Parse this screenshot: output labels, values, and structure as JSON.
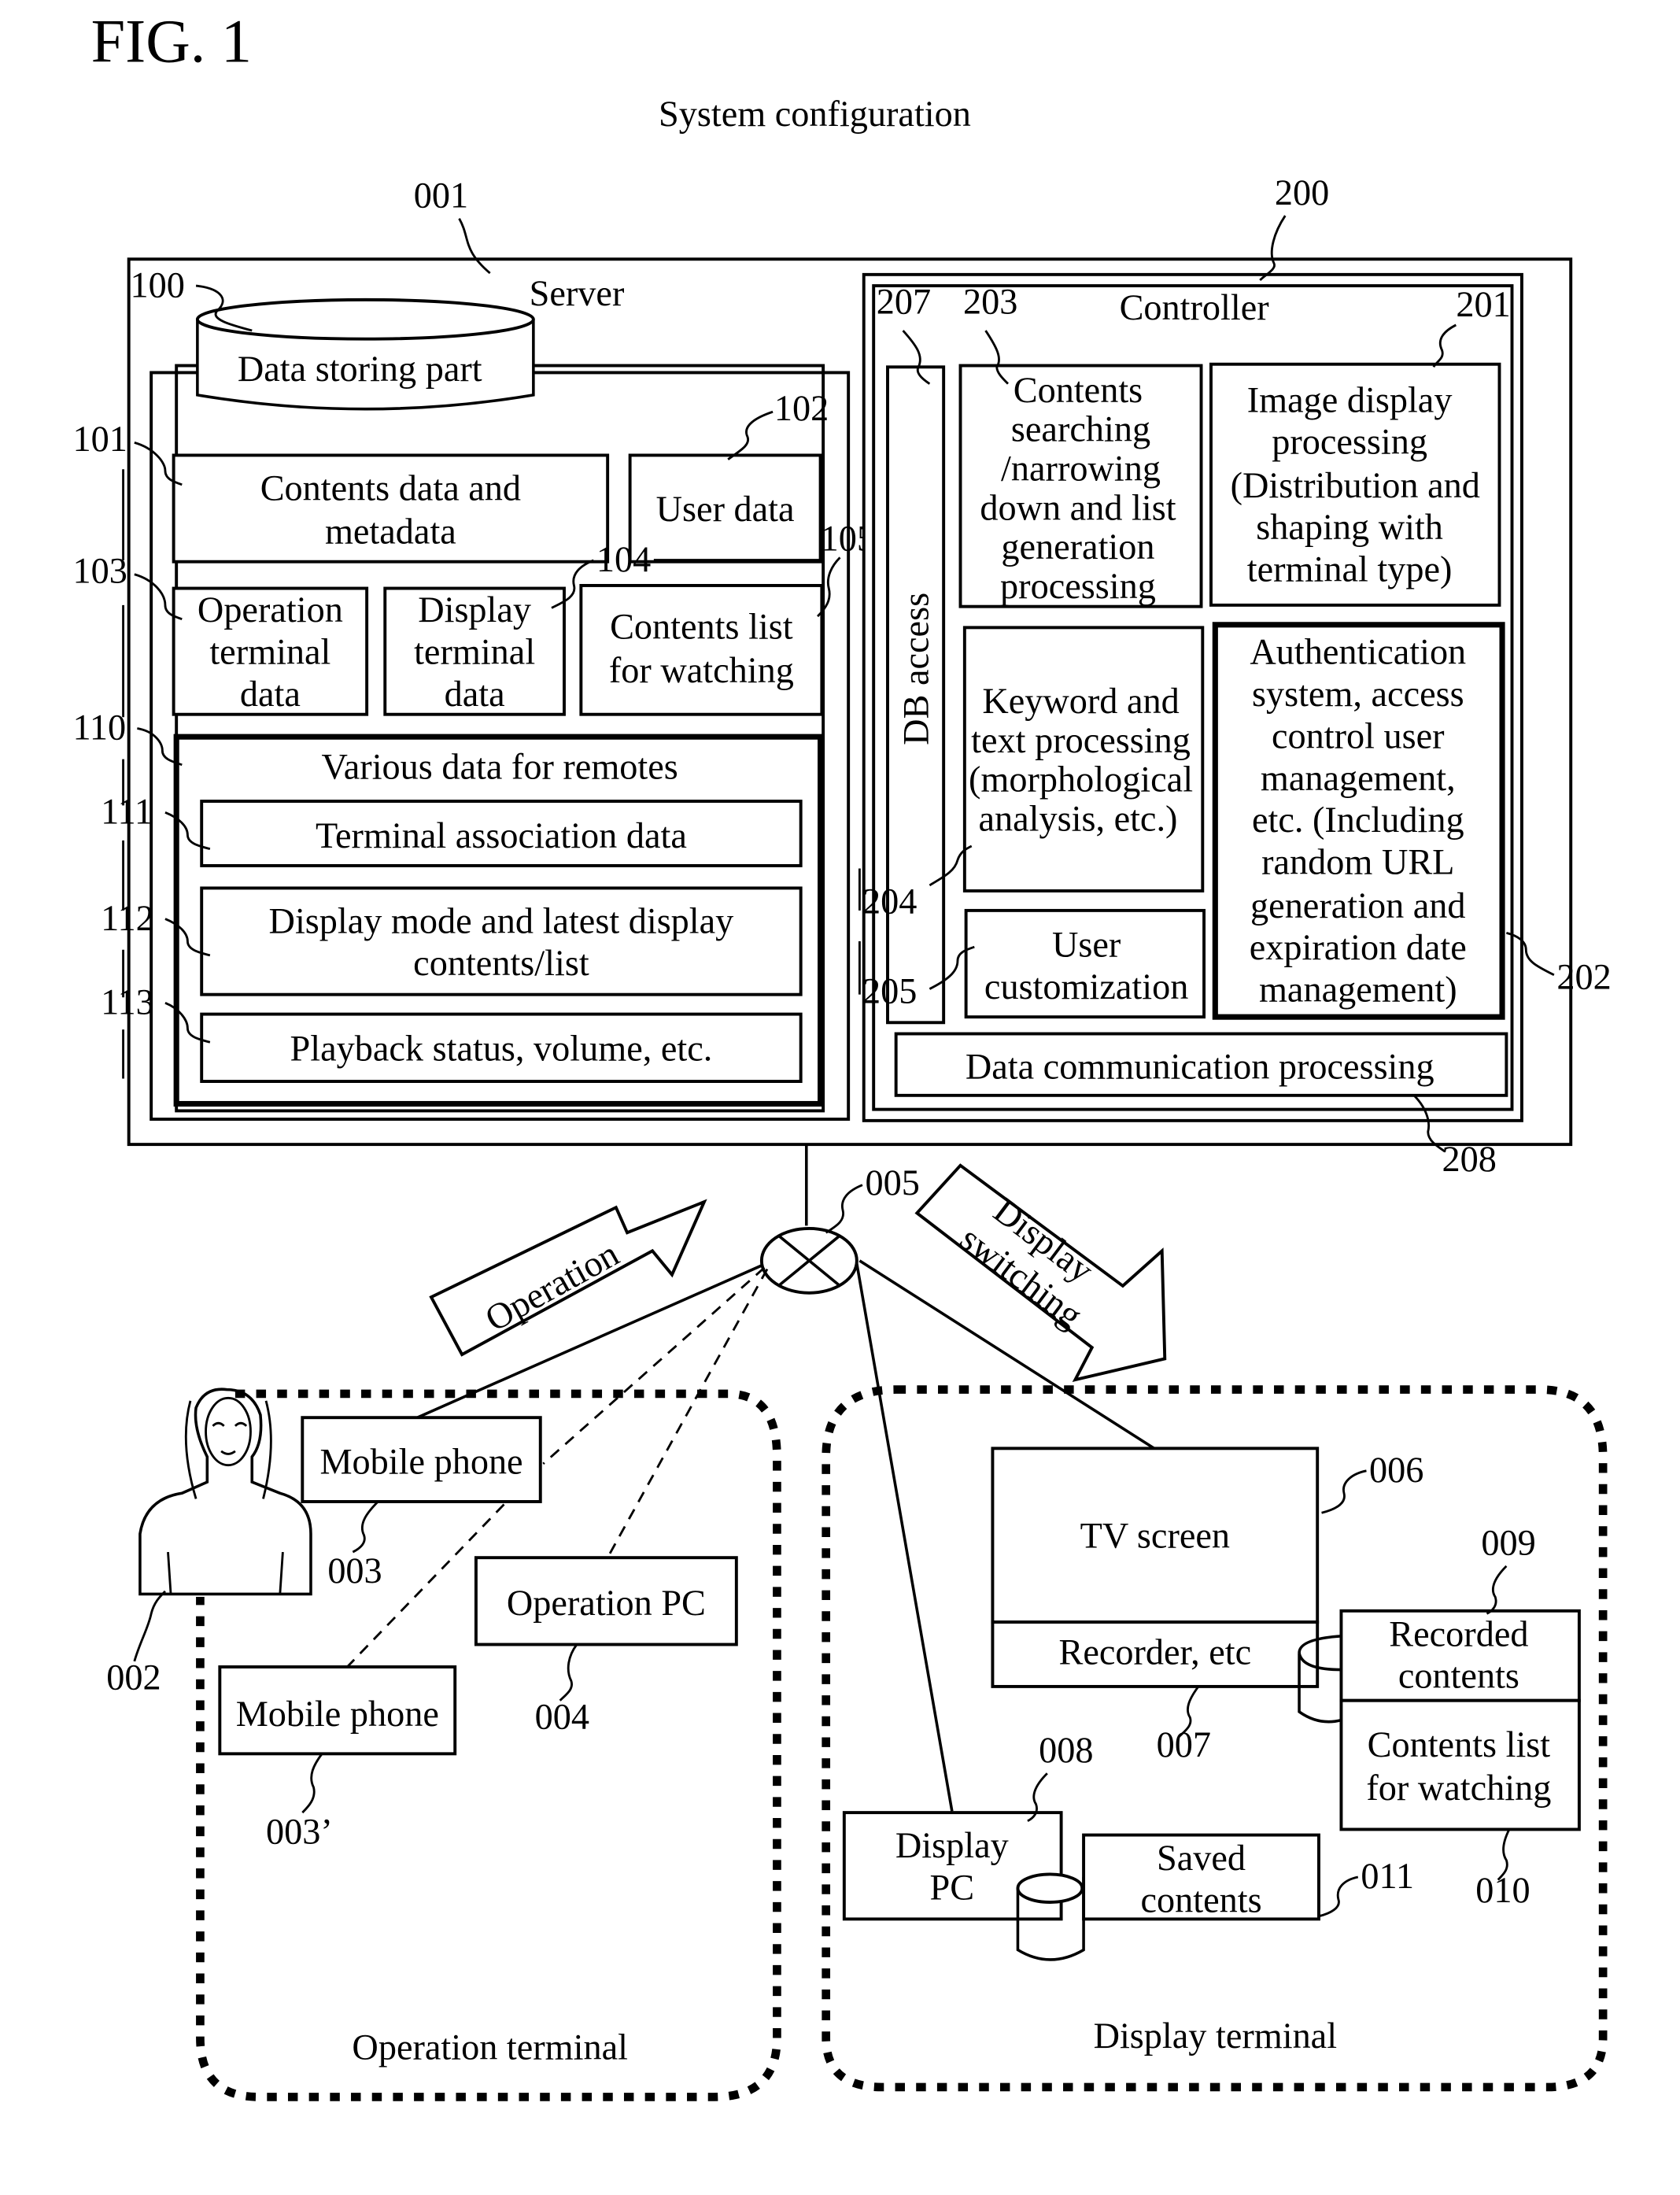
{
  "figure": {
    "label": "FIG. 1",
    "subtitle": "System configuration"
  },
  "server": {
    "ref": "001",
    "label": "Server",
    "data_storing_part": {
      "ref": "100",
      "label": "Data storing part",
      "items": {
        "contents_data": {
          "ref": "101",
          "lines": [
            "Contents data and",
            "metadata"
          ]
        },
        "user_data": {
          "ref": "102",
          "lines": [
            "User data"
          ]
        },
        "operation_terminal_data": {
          "ref": "103",
          "lines": [
            "Operation",
            "terminal",
            "data"
          ]
        },
        "display_terminal_data": {
          "ref": "104",
          "lines": [
            "Display",
            "terminal",
            "data"
          ]
        },
        "contents_list": {
          "ref": "105",
          "lines": [
            "Contents list",
            "for watching"
          ]
        }
      },
      "remotes": {
        "ref": "110",
        "label": "Various data for remotes",
        "terminal_association": {
          "ref": "111",
          "lines": [
            "Terminal association data"
          ]
        },
        "display_mode": {
          "ref": "112",
          "lines": [
            "Display mode and latest display",
            "contents/list"
          ]
        },
        "playback_status": {
          "ref": "113",
          "lines": [
            "Playback status, volume, etc."
          ]
        }
      }
    },
    "controller": {
      "ref": "200",
      "label": "Controller",
      "db_access": {
        "ref": "207",
        "label": "DB access"
      },
      "contents_searching": {
        "ref": "203",
        "lines": [
          "Contents",
          "searching",
          "/narrowing",
          "down and list",
          "generation",
          "processing"
        ]
      },
      "image_display": {
        "ref": "201",
        "lines": [
          "Image display",
          "processing",
          "(Distribution and",
          "shaping with",
          "terminal type)"
        ]
      },
      "keyword_processing": {
        "ref": "204",
        "lines": [
          "Keyword and",
          "text processing",
          "(morphological",
          "analysis, etc.)"
        ]
      },
      "authentication": {
        "ref": "202",
        "lines": [
          "Authentication",
          "system, access",
          "control user",
          "management,",
          "etc. (Including",
          "random URL",
          "generation and",
          "expiration date",
          "management)"
        ]
      },
      "user_customization": {
        "ref": "205",
        "lines": [
          "User",
          "customization"
        ]
      },
      "data_communication": {
        "ref": "208",
        "lines": [
          "Data communication processing"
        ]
      }
    }
  },
  "network": {
    "ref": "005",
    "operation_arrow": "Operation",
    "display_switching_arrow": [
      "Display",
      "switching"
    ]
  },
  "operation_terminal": {
    "label": "Operation terminal",
    "user": {
      "ref": "002"
    },
    "mobile_phone_1": {
      "ref": "003",
      "label": "Mobile phone"
    },
    "mobile_phone_2": {
      "ref": "003’",
      "label": "Mobile phone"
    },
    "operation_pc": {
      "ref": "004",
      "label": "Operation PC"
    }
  },
  "display_terminal": {
    "label": "Display terminal",
    "tv_screen": {
      "ref": "006",
      "label": "TV screen"
    },
    "recorder": {
      "ref": "007",
      "label": "Recorder, etc"
    },
    "display_pc": {
      "ref": "008",
      "lines": [
        "Display",
        "PC"
      ]
    },
    "recorded_contents": {
      "ref": "009",
      "lines": [
        "Recorded",
        "contents"
      ]
    },
    "contents_list": {
      "ref": "010",
      "lines": [
        "Contents list",
        "for watching"
      ]
    },
    "saved_contents": {
      "ref": "011",
      "lines": [
        "Saved",
        "contents"
      ]
    }
  }
}
